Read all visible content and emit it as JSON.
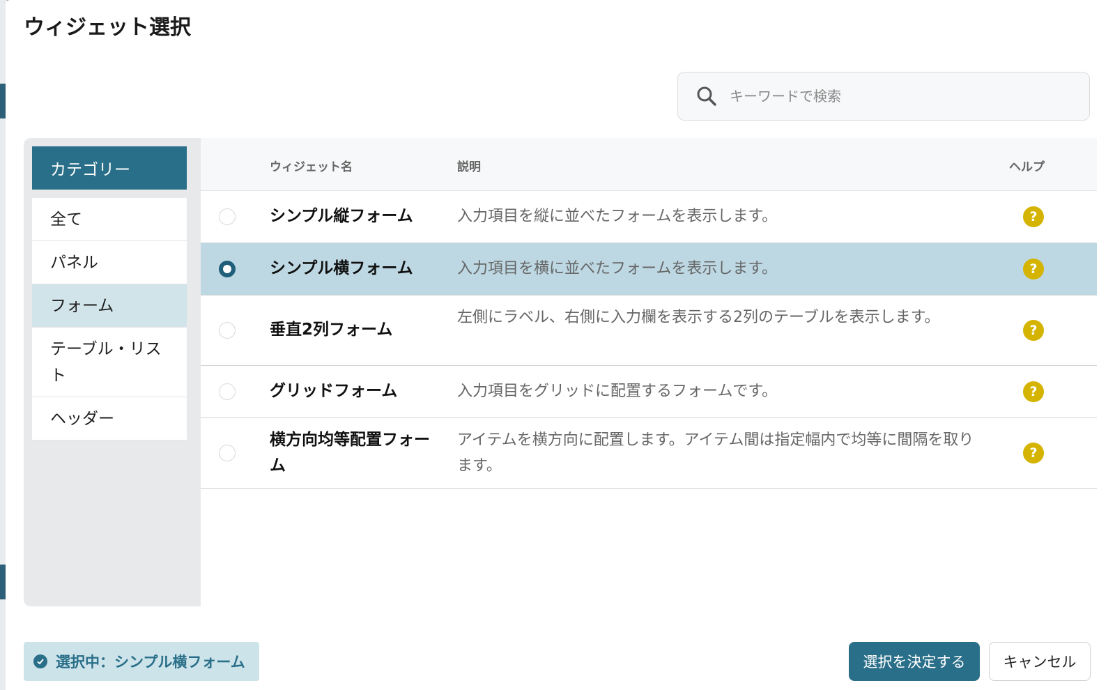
{
  "dialog": {
    "title": "ウィジェット選択"
  },
  "search": {
    "placeholder": "キーワードで検索",
    "icon": "search-icon"
  },
  "category": {
    "header": "カテゴリー",
    "items": [
      {
        "label": "全て",
        "active": false
      },
      {
        "label": "パネル",
        "active": false
      },
      {
        "label": "フォーム",
        "active": true
      },
      {
        "label": "テーブル・リスト",
        "active": false
      },
      {
        "label": "ヘッダー",
        "active": false
      }
    ]
  },
  "table": {
    "headers": {
      "name": "ウィジェット名",
      "description": "説明",
      "help": "ヘルプ"
    },
    "rows": [
      {
        "name": "シンプル縦フォーム",
        "description": "入力項目を縦に並べたフォームを表示します。",
        "selected": false
      },
      {
        "name": "シンプル横フォーム",
        "description": "入力項目を横に並べたフォームを表示します。",
        "selected": true
      },
      {
        "name": "垂直2列フォーム",
        "description": "左側にラベル、右側に入力欄を表示する2列のテーブルを表示します。",
        "selected": false
      },
      {
        "name": "グリッドフォーム",
        "description": "入力項目をグリッドに配置するフォームです。",
        "selected": false
      },
      {
        "name": "横方向均等配置フォーム",
        "description": "アイテムを横方向に配置します。アイテム間は指定幅内で均等に間隔を取ります。",
        "selected": false
      }
    ],
    "help_icon_label": "?"
  },
  "footer": {
    "status_text": "選択中：シンプル横フォーム",
    "confirm_label": "選択を決定する",
    "cancel_label": "キャンセル"
  },
  "colors": {
    "accent": "#2a6f89",
    "selected_row": "#bdd8e3",
    "help_icon": "#d4b400"
  }
}
